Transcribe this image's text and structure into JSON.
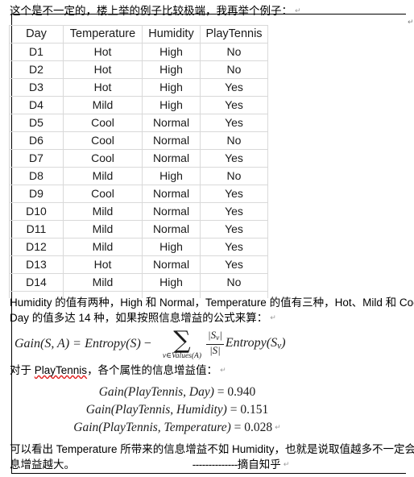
{
  "document": {
    "intro_text": "这个是不一定的，楼上举的例子比较极端，我再举个例子：",
    "paragraph_mark": "↵"
  },
  "table": {
    "headers": [
      "Day",
      "Temperature",
      "Humidity",
      "PlayTennis"
    ],
    "rows": [
      [
        "D1",
        "Hot",
        "High",
        "No"
      ],
      [
        "D2",
        "Hot",
        "High",
        "No"
      ],
      [
        "D3",
        "Hot",
        "High",
        "Yes"
      ],
      [
        "D4",
        "Mild",
        "High",
        "Yes"
      ],
      [
        "D5",
        "Cool",
        "Normal",
        "Yes"
      ],
      [
        "D6",
        "Cool",
        "Normal",
        "No"
      ],
      [
        "D7",
        "Cool",
        "Normal",
        "Yes"
      ],
      [
        "D8",
        "Mild",
        "High",
        "No"
      ],
      [
        "D9",
        "Cool",
        "Normal",
        "Yes"
      ],
      [
        "D10",
        "Mild",
        "Normal",
        "Yes"
      ],
      [
        "D11",
        "Mild",
        "Normal",
        "Yes"
      ],
      [
        "D12",
        "Mild",
        "High",
        "Yes"
      ],
      [
        "D13",
        "Hot",
        "Normal",
        "Yes"
      ],
      [
        "D14",
        "Mild",
        "High",
        "No"
      ]
    ]
  },
  "explanation": {
    "line1": "Humidity 的值有两种，High 和 Normal，Temperature 的值有三种，Hot、Mild 和 Cool，而",
    "line2": "Day 的值多达 14 种，如果按照信息增益的公式来算："
  },
  "formula": {
    "lhs": "Gain(S, A)",
    "equals": "=",
    "entropy_s": "Entropy(S)",
    "minus": "−",
    "sigma": "∑",
    "sum_subscript": "v∈Values(A)",
    "frac_numerator": "|Sv|",
    "frac_denominator": "|S|",
    "entropy_sv": "Entropy(Sv)",
    "plain_text": "Gain(S, A) = Entropy(S) − Σ v∈Values(A) (|Sv|/|S|) Entropy(Sv)"
  },
  "for_playtennis": {
    "prefix": "对于 ",
    "misspelled_word": "PlayTennis",
    "suffix": "，各个属性的信息增益值："
  },
  "gain_results": [
    {
      "expression": "Gain(PlayTennis, Day)",
      "equals": "=",
      "value": "0.940"
    },
    {
      "expression": "Gain(PlayTennis, Humidity)",
      "equals": "=",
      "value": "0.151"
    },
    {
      "expression": "Gain(PlayTennis, Temperature)",
      "equals": "=",
      "value": "0.028"
    }
  ],
  "conclusion": {
    "line1": "可以看出 Temperature 所带来的信息增益不如 Humidity，也就是说取值越多不一定会导致信",
    "line2_text": "息增益越大。",
    "signature_dashes": "--------------",
    "signature_source": "摘自知乎"
  },
  "colors": {
    "table_border": "#d9d9d9",
    "frame_border": "#000000",
    "text": "#000000",
    "spellcheck_underline": "#e01b1b",
    "mark_gray": "#9a9a9a"
  }
}
